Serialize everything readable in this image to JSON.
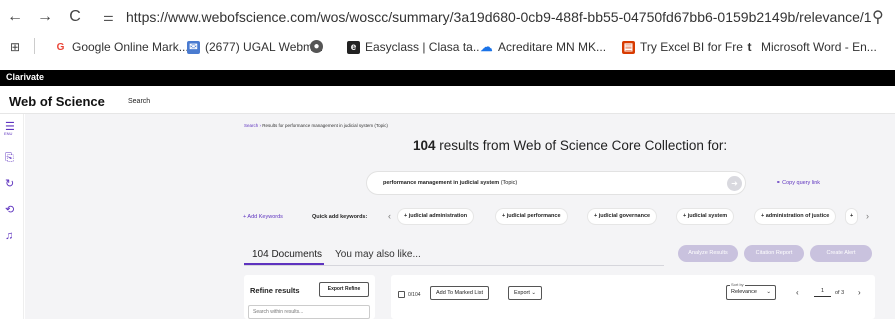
{
  "browser": {
    "url": "https://www.webofscience.com/wos/woscc/summary/3a19d680-0cb9-488f-bb55-04750fd67bb6-0159b2149b/relevance/1"
  },
  "bookmarks": [
    {
      "label": "Google Online Mark...",
      "icon": "google-icon",
      "color": "#ea4335",
      "glyph": "G"
    },
    {
      "label": "(2677) UGAL Webm...",
      "icon": "mail-icon",
      "color": "#4a7bd0",
      "glyph": "✉"
    },
    {
      "label": "",
      "icon": "github-icon",
      "color": "#555555",
      "glyph": "●"
    },
    {
      "label": "Easyclass | Clasa ta...",
      "icon": "easyclass-icon",
      "color": "#222222",
      "glyph": "e"
    },
    {
      "label": "Acreditare MN MK...",
      "icon": "cloud-icon",
      "color": "#1a73e8",
      "glyph": "☁"
    },
    {
      "label": "Try Excel BI for Free",
      "icon": "excel-icon",
      "color": "#d83b01",
      "glyph": "▤"
    },
    {
      "label": "Microsoft Word - En...",
      "icon": "word-icon",
      "color": "#333333",
      "glyph": "t"
    }
  ],
  "clarivate": {
    "label": "Clarivate"
  },
  "wos": {
    "logo": "Web of Science",
    "search_link": "Search"
  },
  "rail": {
    "menu_label": "ENU"
  },
  "breadcrumb": {
    "root": "Search",
    "rest": "Results for performance management in judicial system (Topic)"
  },
  "results": {
    "count": "104",
    "heading_rest": "results from Web of Science Core Collection for:"
  },
  "query": {
    "term": "performance management in judicial system",
    "field": "(Topic)",
    "copy_link": "Copy query link"
  },
  "keywords": {
    "add_label": "+ Add Keywords",
    "quick_label": "Quick add keywords:",
    "items": [
      "+ judicial administration",
      "+ judicial performance",
      "+ judicial governance",
      "+ judicial system",
      "+ administration of justice",
      "+"
    ]
  },
  "tabs": {
    "documents": "104 Documents",
    "other": "You may also like..."
  },
  "actions": {
    "analyze": "Analyze Results",
    "citation": "Citation Report",
    "alert": "Create Alert"
  },
  "refine": {
    "title": "Refine results",
    "export": "Export Refine",
    "search_placeholder": "Search within results..."
  },
  "list_controls": {
    "selected": "0/104",
    "add_marked": "Add To Marked List",
    "export": "Export ⌄",
    "sort_label": "Sort by",
    "sort_value": "Relevance",
    "page": "1",
    "of_pages": "of 3"
  }
}
